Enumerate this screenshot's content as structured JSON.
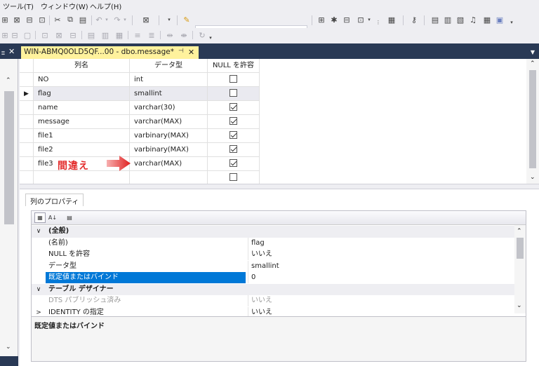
{
  "menu": {
    "tools": "ツール(T)",
    "window": "ウィンドウ(W)",
    "help": "ヘルプ(H)"
  },
  "left_panel": {
    "close_icon": "✕"
  },
  "document_tab": {
    "title": "WIN-ABMQ0OLD5QF...00 - dbo.message*",
    "pin_icon": "⊣",
    "close_icon": "✕"
  },
  "grid": {
    "headers": {
      "name": "列名",
      "type": "データ型",
      "nullable": "NULL を許容"
    },
    "rows": [
      {
        "name": "NO",
        "type": "int",
        "nullable": false,
        "current": false
      },
      {
        "name": "flag",
        "type": "smallint",
        "nullable": false,
        "current": true
      },
      {
        "name": "name",
        "type": "varchar(30)",
        "nullable": true,
        "current": false
      },
      {
        "name": "message",
        "type": "varchar(MAX)",
        "nullable": true,
        "current": false
      },
      {
        "name": "file1",
        "type": "varbinary(MAX)",
        "nullable": true,
        "current": false
      },
      {
        "name": "file2",
        "type": "varbinary(MAX)",
        "nullable": true,
        "current": false
      },
      {
        "name": "file3",
        "type": "varchar(MAX)",
        "nullable": true,
        "current": false
      },
      {
        "name": "",
        "type": "",
        "nullable": false,
        "current": false
      }
    ],
    "current_row_marker": "▶"
  },
  "annotation": {
    "label": "間違え",
    "color": "#e32d2d"
  },
  "properties": {
    "tab_label": "列のプロパティ",
    "rows": [
      {
        "kind": "cat",
        "expander": "∨",
        "name": "(全般)",
        "value": ""
      },
      {
        "kind": "prop",
        "expander": "",
        "name": "(名前)",
        "value": "flag"
      },
      {
        "kind": "prop",
        "expander": "",
        "name": "NULL を許容",
        "value": "いいえ"
      },
      {
        "kind": "prop",
        "expander": "",
        "name": "データ型",
        "value": "smallint"
      },
      {
        "kind": "hl",
        "expander": "",
        "name": "既定値またはバインド",
        "value": "0"
      },
      {
        "kind": "cat",
        "expander": "∨",
        "name": "テーブル デザイナー",
        "value": ""
      },
      {
        "kind": "dim",
        "expander": "",
        "name": "DTS パブリッシュ済み",
        "value": "いいえ"
      },
      {
        "kind": "prop",
        "expander": ">",
        "name": "IDENTITY の指定",
        "value": "いいえ"
      }
    ],
    "description_title": "既定値またはバインド"
  },
  "colors": {
    "dark_band": "#293955",
    "doc_tab": "#fff29d",
    "selection": "#0078d7"
  }
}
